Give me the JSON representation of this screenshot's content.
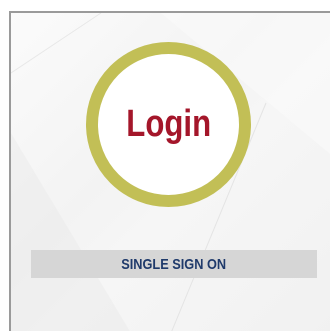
{
  "login": {
    "label": "Login"
  },
  "sso": {
    "label": "SINGLE SIGN ON"
  },
  "colors": {
    "ring": "#c2bf56",
    "login_text": "#a4162a",
    "sso_text": "#1f3a6b",
    "sso_background": "#d6d6d6",
    "panel_border": "#9a9a9a"
  }
}
